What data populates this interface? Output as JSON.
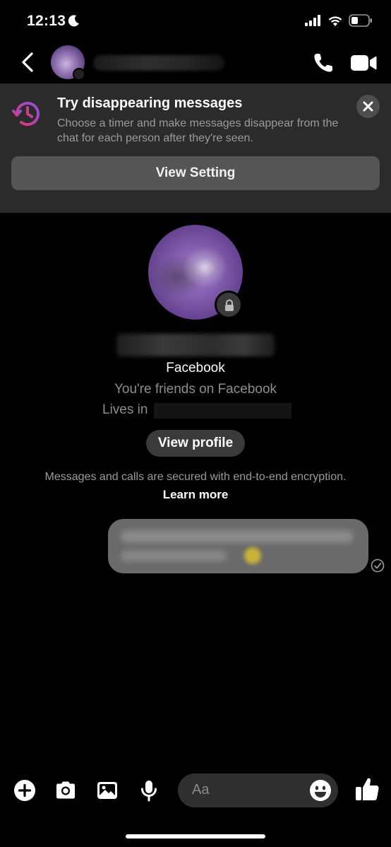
{
  "status_bar": {
    "time": "12:13",
    "icons": [
      "moon-icon",
      "cellular-signal-icon",
      "wifi-icon",
      "battery-icon"
    ]
  },
  "header": {
    "icons": [
      "back-chevron-icon",
      "phone-icon",
      "video-camera-icon"
    ]
  },
  "banner": {
    "title": "Try disappearing messages",
    "description": "Choose a timer and make messages disappear from the chat for each person after they're seen.",
    "button_label": "View Setting",
    "icons": [
      "disappearing-timer-icon",
      "close-icon"
    ]
  },
  "profile": {
    "source": "Facebook",
    "friends_text": "You're friends on Facebook",
    "lives_label": "Lives in",
    "view_profile_label": "View profile"
  },
  "encryption": {
    "text": "Messages and calls are secured with end-to-end encryption.",
    "learn_more": "Learn more"
  },
  "composer": {
    "placeholder": "Aa",
    "icons": [
      "plus-icon",
      "camera-icon",
      "gallery-icon",
      "microphone-icon",
      "emoji-icon",
      "thumbs-up-icon"
    ]
  },
  "colors": {
    "background": "#000000",
    "banner_bg": "#2b2b2b",
    "button_bg": "#555555",
    "pill_bg": "#3a3a3a",
    "accent_gradient": [
      "#e0386c",
      "#8e4fe8"
    ]
  }
}
